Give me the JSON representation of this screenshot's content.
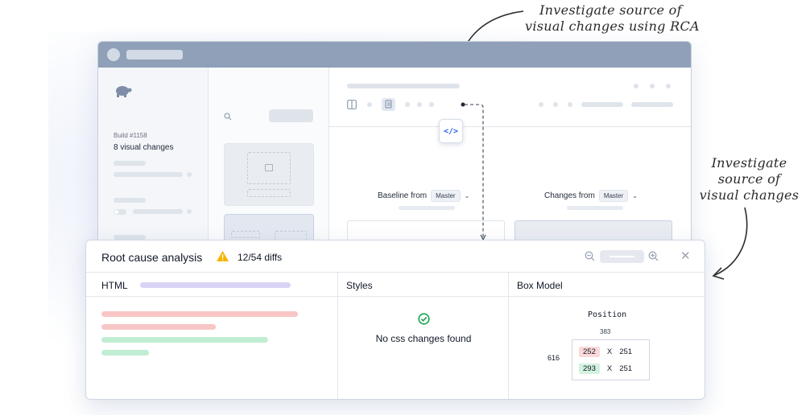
{
  "annotations": {
    "rca_line1": "Investigate source of",
    "rca_line2": "visual changes using RCA",
    "visual_line1": "Investigate",
    "visual_line2": "source of",
    "visual_line3": "visual changes"
  },
  "sidebar": {
    "build_number": "Build #1158",
    "visual_changes": "8 visual changes"
  },
  "compare": {
    "baseline_label": "Baseline from",
    "baseline_branch": "Master",
    "changes_label": "Changes from",
    "changes_branch": "Master",
    "code_button_icon": "code-icon"
  },
  "rca": {
    "title": "Root cause analysis",
    "diffs": "12/54 diffs",
    "columns": {
      "html": "HTML",
      "styles": "Styles",
      "box_model": "Box Model"
    },
    "styles_message": "No css changes found",
    "box_model": {
      "title": "Position",
      "top": "383",
      "left": "616",
      "baseline_x": "252",
      "baseline_sep": "X",
      "baseline_y": "251",
      "current_x": "293",
      "current_sep": "X",
      "current_y": "251"
    }
  },
  "colors": {
    "accent": "#2563eb",
    "warning": "#f5b400",
    "success": "#16a34a",
    "removed": "#f8c6c6",
    "added": "#bfeed3",
    "titlebar": "#8fa0b8"
  }
}
